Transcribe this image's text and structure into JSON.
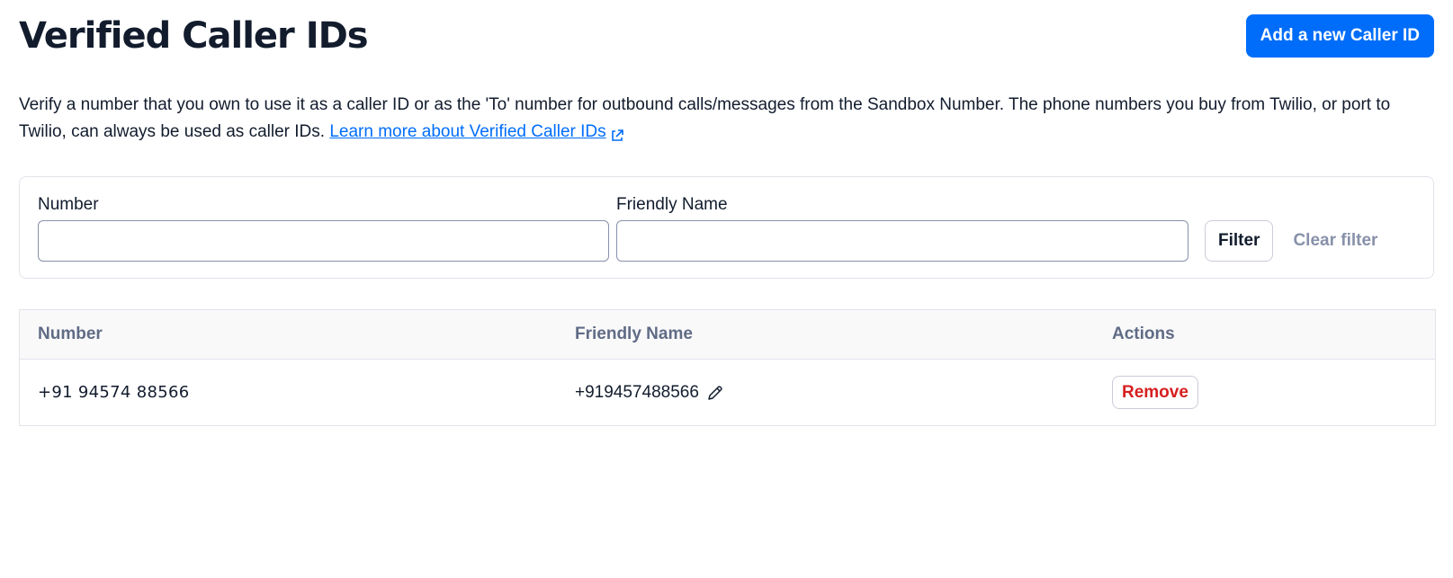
{
  "header": {
    "title": "Verified Caller IDs",
    "add_button_label": "Add a new Caller ID"
  },
  "description": {
    "text": "Verify a number that you own to use it as a caller ID or as the 'To' number for outbound calls/messages from the Sandbox Number. The phone numbers you buy from Twilio, or port to Twilio, can always be used as caller IDs.",
    "link_text": "Learn more about Verified Caller IDs",
    "link_icon": "external-link-icon"
  },
  "filter": {
    "number_label": "Number",
    "number_value": "",
    "friendly_name_label": "Friendly Name",
    "friendly_name_value": "",
    "filter_button_label": "Filter",
    "clear_button_label": "Clear filter"
  },
  "table": {
    "columns": [
      "Number",
      "Friendly Name",
      "Actions"
    ],
    "rows": [
      {
        "number": "+91 94574 88566",
        "friendly_name": "+919457488566",
        "edit_icon": "pencil-icon",
        "action_label": "Remove"
      }
    ]
  },
  "colors": {
    "primary": "#006dfa",
    "destructive": "#d61f1f",
    "text": "#121c2d",
    "muted": "#606b85"
  }
}
